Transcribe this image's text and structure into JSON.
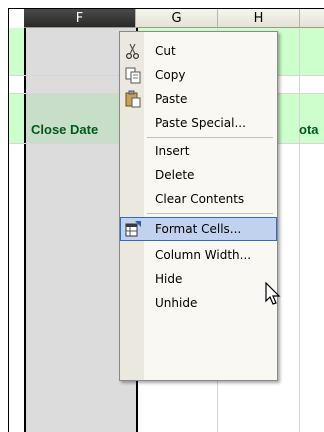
{
  "columns": [
    {
      "letter": "F",
      "selected": true
    },
    {
      "letter": "G",
      "selected": false
    },
    {
      "letter": "H",
      "selected": false
    }
  ],
  "cells": {
    "f_header_text": "Close Date",
    "g_partial_text": "ota"
  },
  "menu": {
    "items": [
      {
        "label": "Cut",
        "icon": "scissors-icon"
      },
      {
        "label": "Copy",
        "icon": "copy-icon"
      },
      {
        "label": "Paste",
        "icon": "paste-icon"
      },
      {
        "label": "Paste Special...",
        "icon": ""
      },
      {
        "label": "Insert",
        "icon": ""
      },
      {
        "label": "Delete",
        "icon": ""
      },
      {
        "label": "Clear Contents",
        "icon": ""
      },
      {
        "label": "Format Cells...",
        "icon": "format-cells-icon",
        "highlighted": true
      },
      {
        "label": "Column Width...",
        "icon": ""
      },
      {
        "label": "Hide",
        "icon": ""
      },
      {
        "label": "Unhide",
        "icon": ""
      }
    ]
  },
  "colors": {
    "header_band": "#ccffcc",
    "highlight": "#c1d2ee",
    "text_green": "#005a1e"
  }
}
